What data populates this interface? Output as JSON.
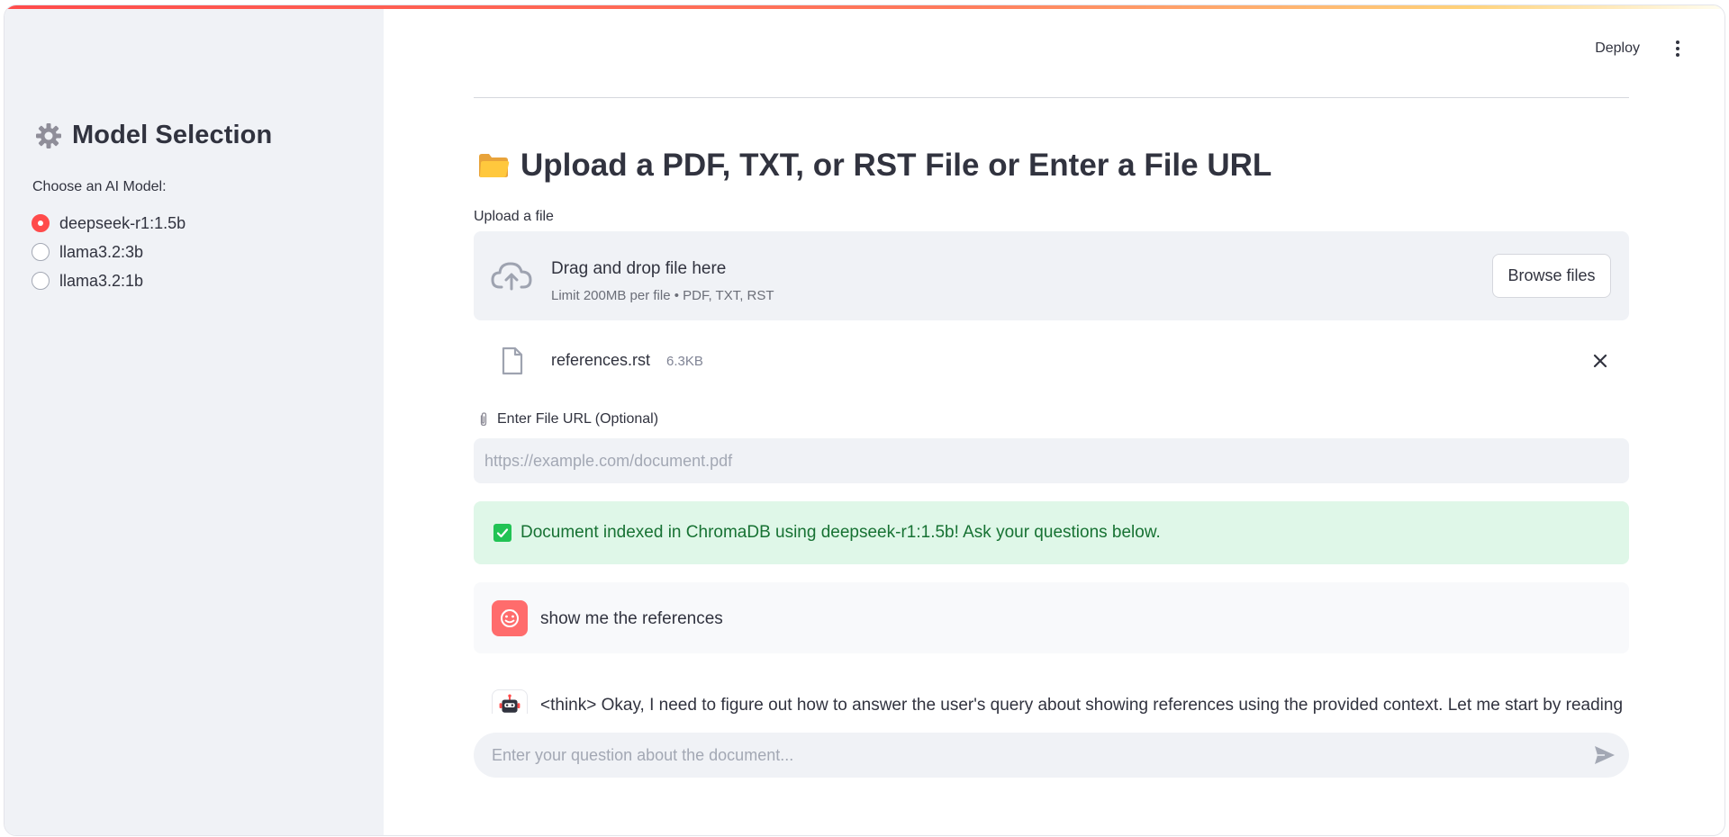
{
  "header": {
    "deploy_label": "Deploy",
    "menu_icon": "kebab-menu-icon"
  },
  "sidebar": {
    "title": "Model Selection",
    "title_icon": "gear-icon",
    "radio_label": "Choose an AI Model:",
    "models": [
      {
        "label": "deepseek-r1:1.5b",
        "selected": true
      },
      {
        "label": "llama3.2:3b",
        "selected": false
      },
      {
        "label": "llama3.2:1b",
        "selected": false
      }
    ]
  },
  "main": {
    "title": "Upload a PDF, TXT, or RST File or Enter a File URL",
    "title_icon": "folder-icon",
    "upload": {
      "label": "Upload a file",
      "drop_text": "Drag and drop file here",
      "limit_text": "Limit 200MB per file • PDF, TXT, RST",
      "browse_label": "Browse files"
    },
    "uploaded_file": {
      "name": "references.rst",
      "size": "6.3KB"
    },
    "url": {
      "label": "Enter File URL (Optional)",
      "value": "",
      "placeholder": "https://example.com/document.pdf"
    },
    "status": {
      "text": "Document indexed in ChromaDB using deepseek-r1:1.5b! Ask your questions below."
    },
    "chat": {
      "messages": [
        {
          "role": "user",
          "text": "show me the references"
        },
        {
          "role": "assistant",
          "text": "<think> Okay, I need to figure out how to answer the user's query about showing references using the provided context. Let me start by reading"
        }
      ],
      "input_placeholder": "Enter your question about the document..."
    }
  },
  "colors": {
    "primary": "#ff4b4b",
    "sidebar_bg": "#f0f2f6",
    "success_bg": "#dff7e8",
    "success_text": "#177233"
  }
}
